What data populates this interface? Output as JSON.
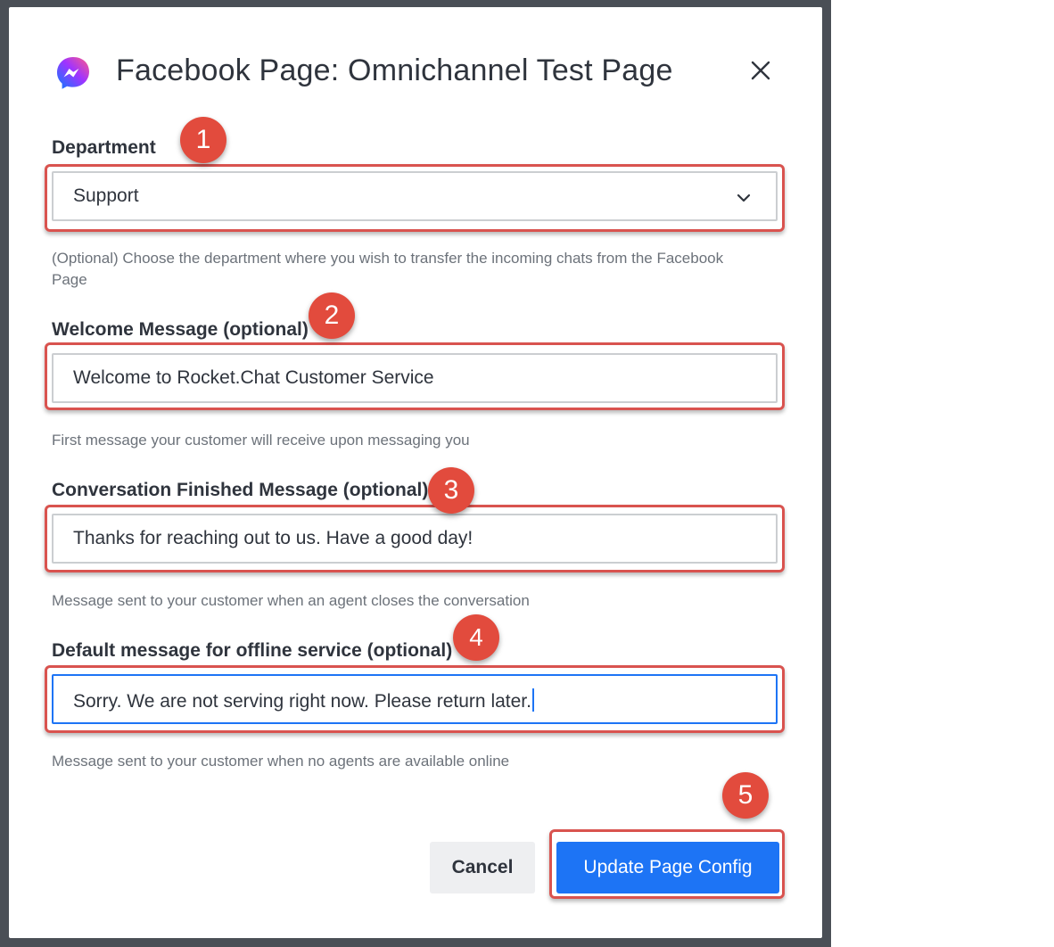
{
  "modal": {
    "title": "Facebook Page: Omnichannel Test Page"
  },
  "fields": {
    "department": {
      "label": "Department",
      "value": "Support",
      "hint": "(Optional) Choose the department where you wish to transfer the incoming chats from the Facebook Page"
    },
    "welcome": {
      "label": "Welcome Message (optional)",
      "value": "Welcome to Rocket.Chat Customer Service",
      "hint": "First message your customer will receive upon messaging you"
    },
    "finished": {
      "label": "Conversation Finished Message (optional)",
      "value": "Thanks for reaching out to us. Have a good day!",
      "hint": "Message sent to your customer when an agent closes the conversation"
    },
    "offline": {
      "label": "Default message for offline service (optional)",
      "value": "Sorry. We are not serving right now. Please return later.",
      "hint": "Message sent to your customer when no agents are available online"
    }
  },
  "buttons": {
    "cancel": "Cancel",
    "submit": "Update Page Config"
  },
  "callouts": [
    "1",
    "2",
    "3",
    "4",
    "5"
  ],
  "icons": {
    "logo": "messenger-icon",
    "close": "close-icon",
    "select": "chevron-down-icon"
  },
  "colors": {
    "primary": "#1d74f5",
    "annotation": "#e24b3d"
  }
}
